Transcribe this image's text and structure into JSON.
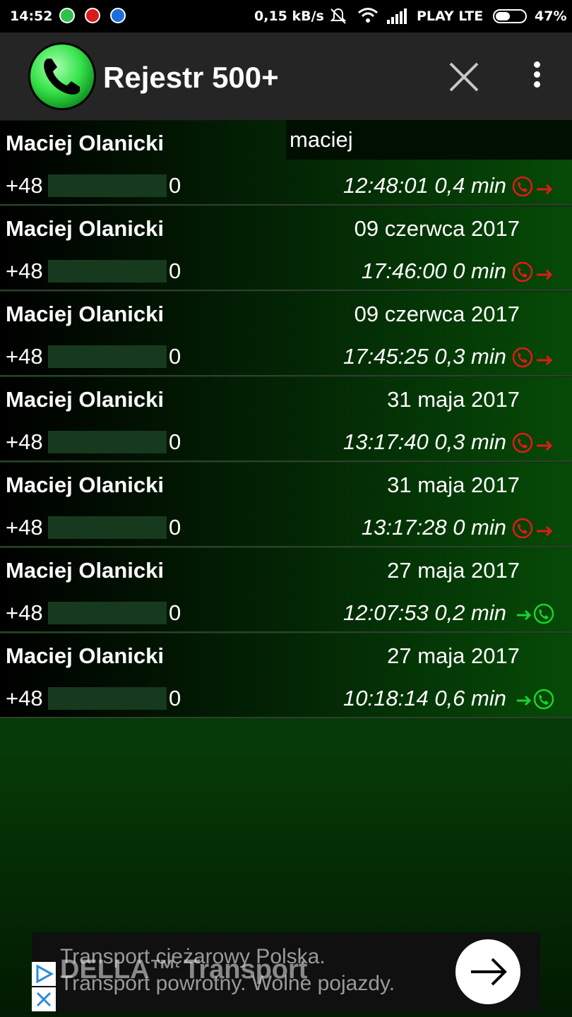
{
  "status_bar": {
    "time": "14:52",
    "data_rate": "0,15 kB/s",
    "carrier": "PLAY LTE",
    "battery": "47%"
  },
  "app": {
    "title": "Rejestr 500+"
  },
  "search": {
    "value": "maciej"
  },
  "calls": [
    {
      "name": "Maciej Olanicki",
      "date": "",
      "phone_prefix": "+48",
      "phone_suffix": "0",
      "time": "12:48:01",
      "duration": "0,4 min",
      "type": "outgoing"
    },
    {
      "name": "Maciej Olanicki",
      "date": "09 czerwca 2017",
      "phone_prefix": "+48",
      "phone_suffix": "0",
      "time": "17:46:00",
      "duration": "0 min",
      "type": "outgoing"
    },
    {
      "name": "Maciej Olanicki",
      "date": "09 czerwca 2017",
      "phone_prefix": "+48",
      "phone_suffix": "0",
      "time": "17:45:25",
      "duration": "0,3 min",
      "type": "outgoing"
    },
    {
      "name": "Maciej Olanicki",
      "date": "31 maja 2017",
      "phone_prefix": "+48",
      "phone_suffix": "0",
      "time": "13:17:40",
      "duration": "0,3 min",
      "type": "outgoing"
    },
    {
      "name": "Maciej Olanicki",
      "date": "31 maja 2017",
      "phone_prefix": "+48",
      "phone_suffix": "0",
      "time": "13:17:28",
      "duration": "0 min",
      "type": "outgoing"
    },
    {
      "name": "Maciej Olanicki",
      "date": "27 maja 2017",
      "phone_prefix": "+48",
      "phone_suffix": "0",
      "time": "12:07:53",
      "duration": "0,2 min",
      "type": "incoming"
    },
    {
      "name": "Maciej Olanicki",
      "date": "27 maja 2017",
      "phone_prefix": "+48",
      "phone_suffix": "0",
      "time": "10:18:14",
      "duration": "0,6 min",
      "type": "incoming"
    }
  ],
  "ad": {
    "line1": "Transport ciężarowy Polska.",
    "line2": "Transport powrotny. Wolne pojazdy.",
    "brand": "DELLA™ Transport"
  },
  "colors": {
    "outgoing": "#e01a1a",
    "incoming": "#19d42c",
    "app_bar": "#252525"
  },
  "icons": {
    "logo": "phone-handset-icon",
    "close": "close-icon",
    "menu": "more-vert-icon",
    "outgoing": "outgoing-call-icon",
    "incoming": "incoming-call-icon"
  }
}
